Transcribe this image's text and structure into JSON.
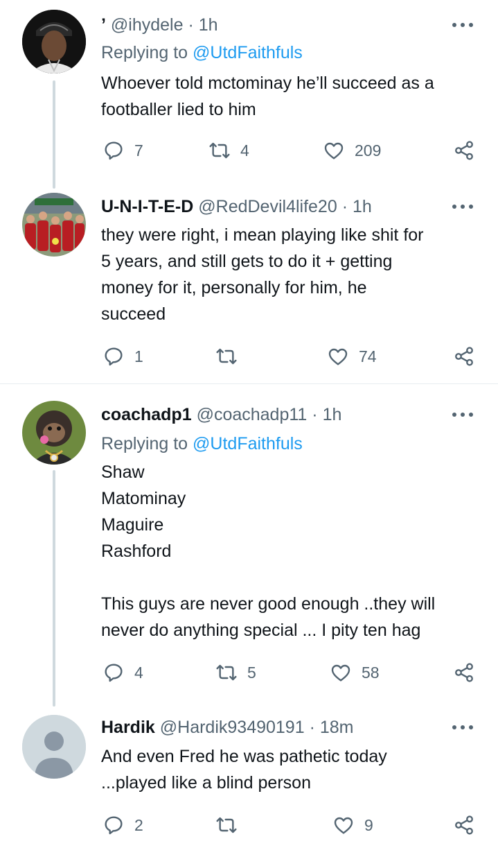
{
  "tweets": [
    {
      "name": "’",
      "handle": "@ihydele",
      "time": "1h",
      "replying_label": "Replying to",
      "replying_handle": "@UtdFaithfuls",
      "lines": [
        "Whoever told mctominay he’ll succeed as a",
        "footballer lied to him"
      ],
      "replies": "7",
      "retweets": "4",
      "likes": "209"
    },
    {
      "name": "U-N-I-T-E-D",
      "handle": "@RedDevil4life20",
      "time": "1h",
      "lines": [
        "they were right, i mean playing like shit for",
        "5 years, and still gets to do it + getting",
        "money for it, personally for him, he",
        "succeed"
      ],
      "replies": "1",
      "retweets": "",
      "likes": "74"
    },
    {
      "name": "coachadp1",
      "handle": "@coachadp11",
      "time": "1h",
      "replying_label": "Replying to",
      "replying_handle": "@UtdFaithfuls",
      "lines": [
        "Shaw",
        "Matominay",
        "Maguire",
        "Rashford",
        "",
        "This guys are never good enough ..they will",
        "never do anything special ... I pity ten hag"
      ],
      "replies": "4",
      "retweets": "5",
      "likes": "58"
    },
    {
      "name": "Hardik",
      "handle": "@Hardik93490191",
      "time": "18m",
      "lines": [
        "And even Fred he was pathetic today",
        "...played like a blind person"
      ],
      "replies": "2",
      "retweets": "",
      "likes": "9"
    }
  ],
  "separator": "·",
  "icons": {
    "reply": "reply-icon",
    "retweet": "retweet-icon",
    "like": "heart-icon",
    "share": "share-icon",
    "more": "more-options-icon"
  },
  "colors": {
    "link": "#1d9bf0",
    "meta": "#536471",
    "thread": "#cfd9de"
  }
}
